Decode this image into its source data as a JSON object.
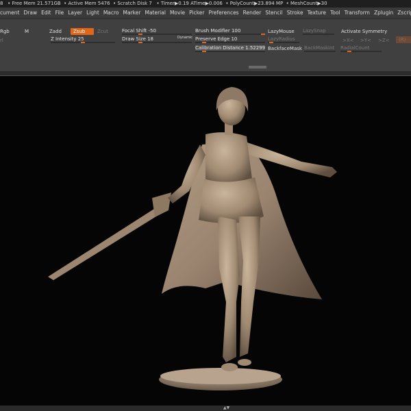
{
  "status": {
    "items": [
      "8",
      "• Free Mem 21.571GB",
      "• Active Mem 5476",
      "• Scratch Disk 7",
      "• Timer▶0.19 ATime▶0.006",
      "• PolyCount▶23.894 MP",
      "• MeshCount▶30"
    ]
  },
  "menu": [
    "cument",
    "Draw",
    "Edit",
    "File",
    "Layer",
    "Light",
    "Macro",
    "Marker",
    "Material",
    "Movie",
    "Picker",
    "Preferences",
    "Render",
    "Stencil",
    "Stroke",
    "Texture",
    "Tool",
    "Transform",
    "Zplugin",
    "Zscript",
    "Zs"
  ],
  "toolbar": {
    "rgb": "Rgb",
    "m": "M",
    "zadd": "Zadd",
    "zsub": "Zsub",
    "zcut": "Zcut",
    "z_intensity": {
      "label": "Z Intensity 25",
      "value": 25
    },
    "focal_shift": {
      "label": "Focal Shift -50",
      "value": -50
    },
    "draw_size": {
      "label": "Draw Size 18",
      "value": 18
    },
    "dynamic": "Dynamic",
    "brush_modifier": {
      "label": "Brush Modifier 100",
      "value": 100
    },
    "preserve_edge": {
      "label": "Preserve Edge 10",
      "value": 10
    },
    "calibration_distance": {
      "label": "Calibration Distance 1.52299",
      "value": 1.52299
    },
    "lazy_mouse": "LazyMouse",
    "lazy_snap": "LazySnap",
    "lazy_radius": "LazyRadius",
    "backface_mask": "BackfaceMask",
    "back_mask_int": "BackMaskInt",
    "radial_count": "RadialCount",
    "activate_symmetry": "Activate Symmetry",
    "sym_x": ">X<",
    "sym_y": ">Y<",
    "sym_z": ">Z<",
    "sym_r": "(R)",
    "left_value": "rl"
  },
  "colors": {
    "accent": "#e0661a",
    "viewport": "#050505",
    "model": "#a89580"
  },
  "viewport": {
    "subject": "3D sculpt: female knight with sword and cape on round base"
  },
  "bottom": {
    "arrows": "▲▼"
  }
}
